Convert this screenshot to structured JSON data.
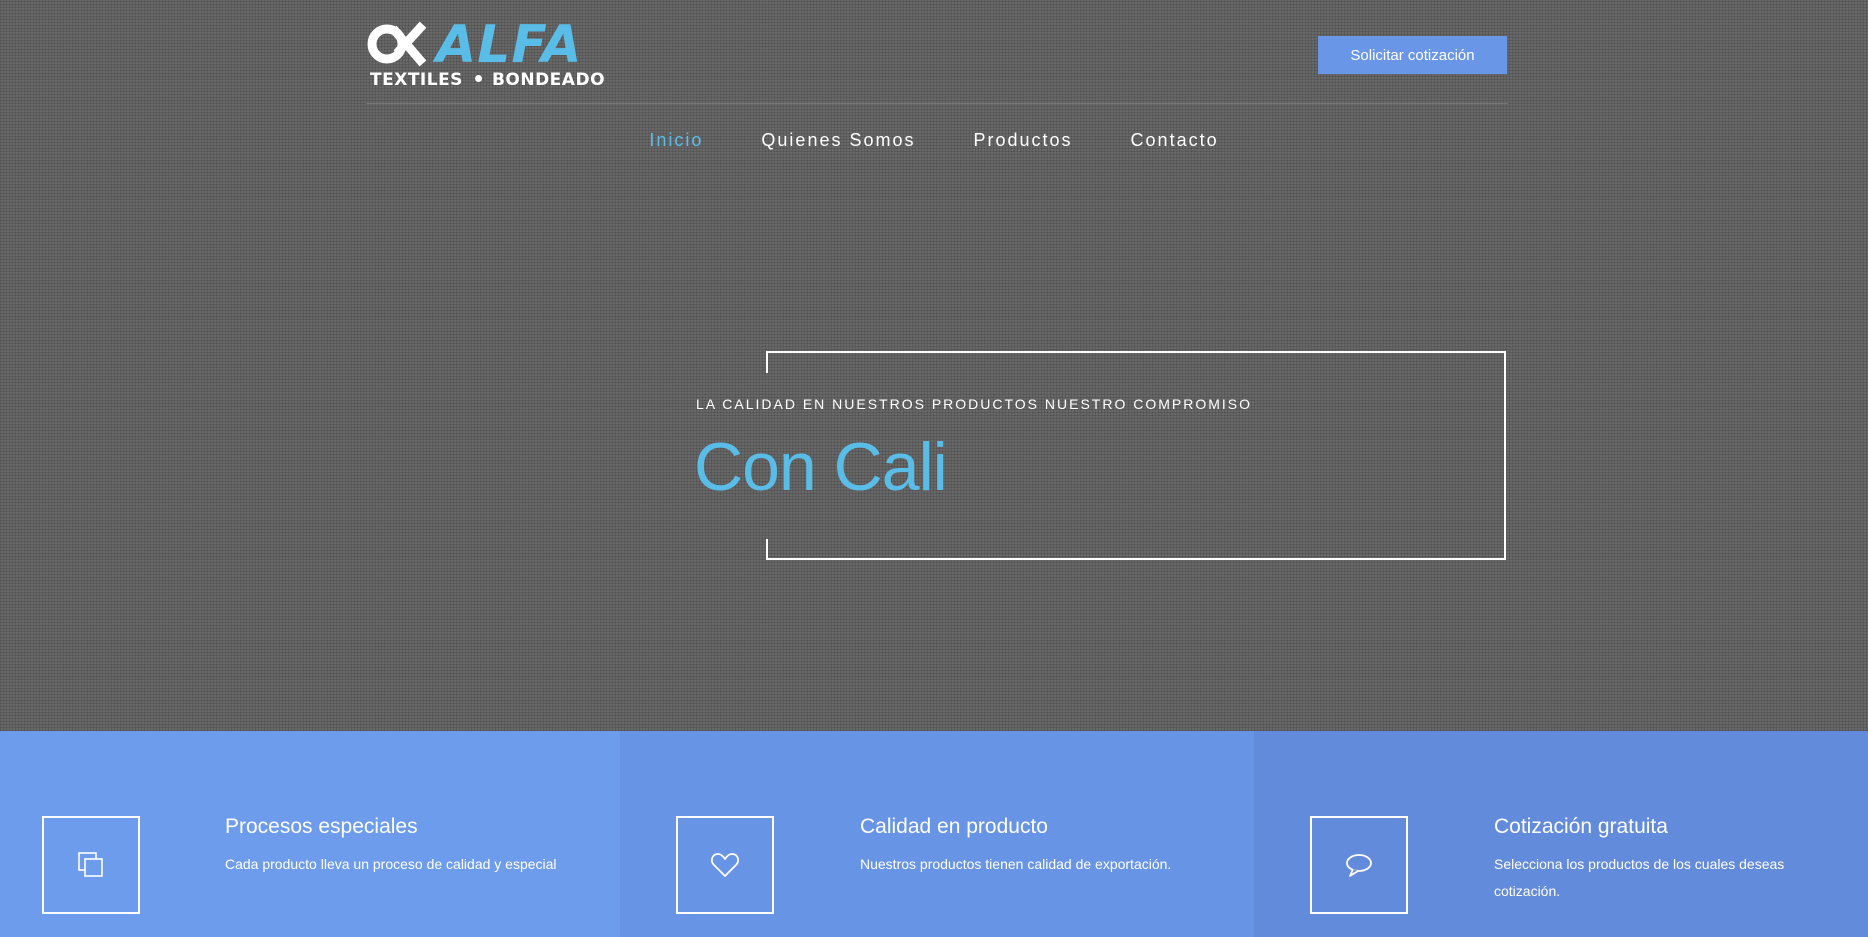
{
  "header": {
    "logo": {
      "word": "ALFA",
      "sub_left": "TEXTILES",
      "sub_right": "BONDEADO",
      "mark_icon": "alpha-infinity-icon"
    },
    "quote_button": "Solicitar cotización"
  },
  "nav": {
    "items": [
      {
        "label": "Inicio",
        "active": true
      },
      {
        "label": "Quienes Somos",
        "active": false
      },
      {
        "label": "Productos",
        "active": false
      },
      {
        "label": "Contacto",
        "active": false
      }
    ]
  },
  "hero": {
    "tagline": "LA CALIDAD EN NUESTROS PRODUCTOS NUESTRO COMPROMISO",
    "headline": "Con Cali"
  },
  "features": [
    {
      "icon": "layers-icon",
      "title": "Procesos especiales",
      "description": "Cada producto lleva un proceso de calidad y especial",
      "bg": "#6e9cec"
    },
    {
      "icon": "heart-icon",
      "title": "Calidad en producto",
      "description": "Nuestros productos tienen calidad de exportación.",
      "bg": "#6894e6"
    },
    {
      "icon": "chat-bubble-icon",
      "title": "Cotización gratuita",
      "description": "Selecciona los productos de los cuales deseas cotización.",
      "bg": "#638bdc"
    }
  ],
  "colors": {
    "accent": "#59bde8",
    "button": "#6a96e8"
  }
}
